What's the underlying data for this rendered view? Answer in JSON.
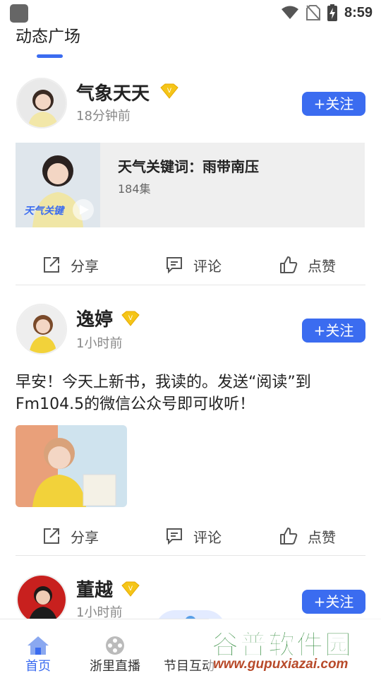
{
  "status_bar": {
    "time": "8:59"
  },
  "header": {
    "title": "动态广场"
  },
  "colors": {
    "accent": "#3b6cf0",
    "vip_gold": "#f5c518"
  },
  "posts": [
    {
      "user": "气象天天",
      "time": "18分钟前",
      "follow_label": "+关注",
      "album": {
        "title": "天气关键词：雨带南压",
        "count": "184集",
        "cover_caption": "天气关键"
      },
      "actions": {
        "share": "分享",
        "comment": "评论",
        "like": "点赞"
      }
    },
    {
      "user": "逸婷",
      "time": "1小时前",
      "follow_label": "+关注",
      "text": "早安！今天上新书，我读的。发送“阅读”到Fm104.5的微信公众号即可收听！",
      "actions": {
        "share": "分享",
        "comment": "评论",
        "like": "点赞"
      }
    },
    {
      "user": "董越",
      "time": "1小时前",
      "follow_label": "+关注"
    }
  ],
  "bottom_nav": {
    "items": [
      {
        "label": "首页",
        "icon": "home-icon",
        "active": true
      },
      {
        "label": "浙里直播",
        "icon": "film-reel-icon",
        "active": false
      },
      {
        "label": "节目互动",
        "icon": "microphone-icon",
        "active": false
      }
    ]
  },
  "watermark": {
    "main": "谷普软件园",
    "url": "www.gupuxiazai.com"
  }
}
